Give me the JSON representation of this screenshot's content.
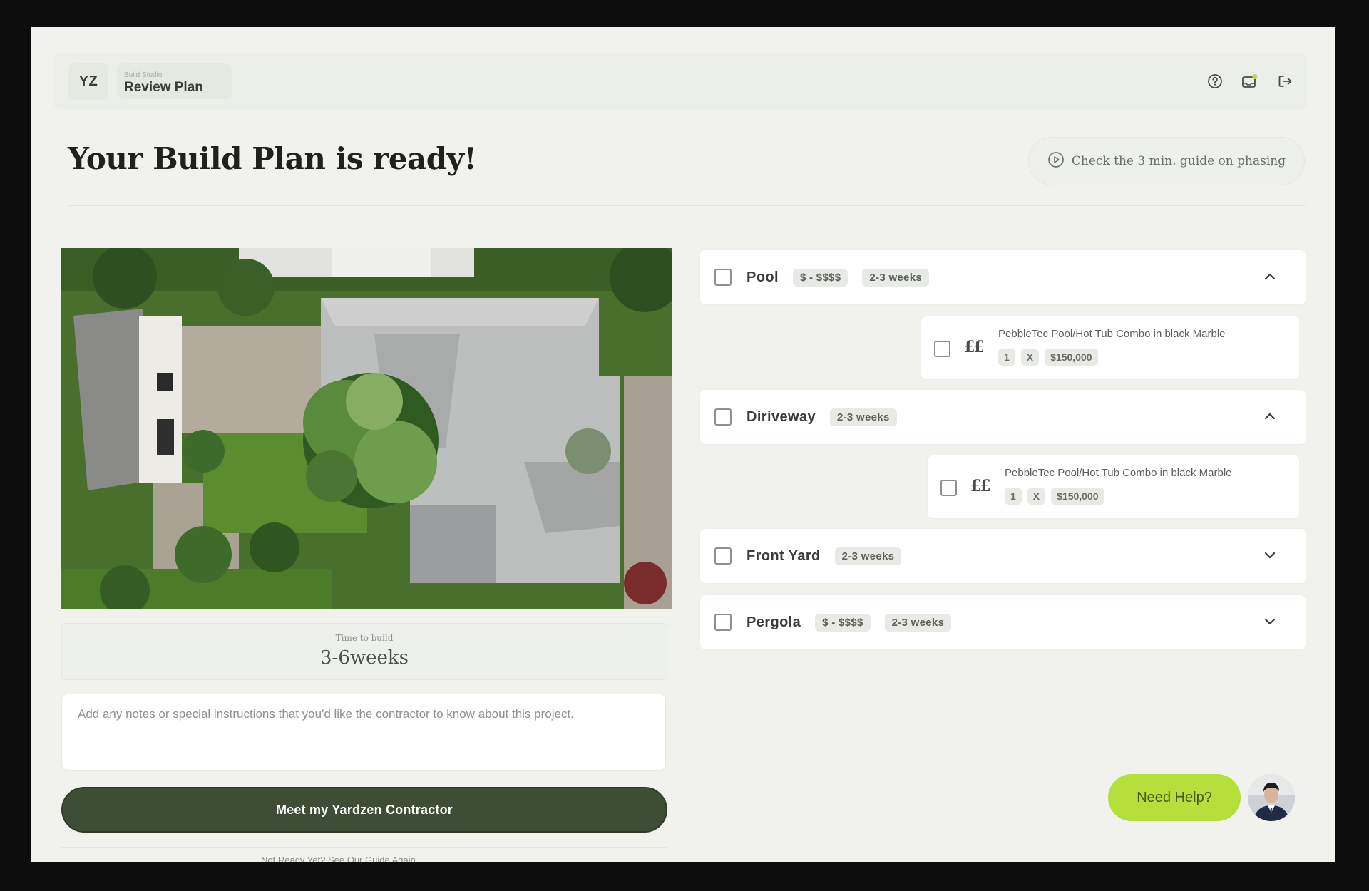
{
  "header": {
    "logo": "YZ",
    "section_label": "Build Studio",
    "page_name": "Review Plan",
    "icons": [
      "help-circle-icon",
      "notification-icon",
      "logout-icon"
    ]
  },
  "main": {
    "title": "Your Build Plan is ready!",
    "guide_link": "Check the 3 min. guide on phasing"
  },
  "summary": {
    "time_label": "Time to build",
    "time_value": "3-6weeks",
    "notes_placeholder": "Add any notes or special instructions that you'd like the contractor to know about this project.",
    "cta_label": "Meet my Yardzen Contractor",
    "cut_text": "Not Ready Yet? See Our Guide Again"
  },
  "categories": [
    {
      "name": "Pool",
      "price": "$ - $$$$",
      "duration": "2-3 weeks",
      "expanded": true,
      "item": {
        "name": "PebbleTec Pool/Hot Tub Combo in black Marble",
        "qty": "1",
        "x": "X",
        "price": "$150,000",
        "symbol": "££"
      }
    },
    {
      "name": "Diriveway",
      "duration": "2-3 weeks",
      "expanded": true,
      "item": {
        "name": "PebbleTec Pool/Hot Tub Combo in black Marble",
        "qty": "1",
        "x": "X",
        "price": "$150,000",
        "symbol": "££"
      }
    },
    {
      "name": "Front Yard",
      "duration": "2-3 weeks",
      "expanded": false
    },
    {
      "name": "Pergola",
      "price": "$ - $$$$",
      "duration": "2-3 weeks",
      "expanded": false
    }
  ],
  "support": {
    "help_label": "Need Help?"
  },
  "colors": {
    "cta": "#3e4d36",
    "help": "#b5df3a",
    "background": "#f1f2ee"
  }
}
